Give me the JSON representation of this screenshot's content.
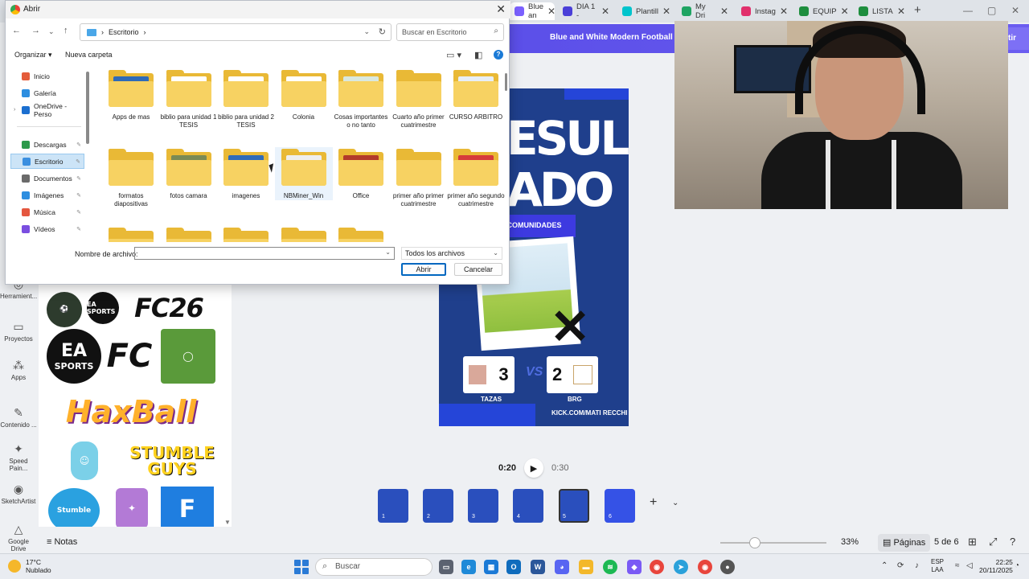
{
  "browser": {
    "tabs": [
      {
        "label": "Blue an",
        "color": "#7b61ff",
        "active": true
      },
      {
        "label": "DIA 1 -",
        "color": "#4a3fd8"
      },
      {
        "label": "Plantill",
        "color": "#00c4cc"
      },
      {
        "label": "My Dri",
        "color": "#1fa463"
      },
      {
        "label": "Instag",
        "color": "#e1306c"
      },
      {
        "label": "EQUIP",
        "color": "#1e8e3e"
      },
      {
        "label": "LISTA",
        "color": "#1e8e3e"
      }
    ],
    "new_tab": "+",
    "close_glyph": "✕"
  },
  "canva": {
    "doc_title": "Blue and White Modern Football M",
    "share_label": "tir",
    "rail": [
      {
        "label": "Herramient...",
        "icon": "◎"
      },
      {
        "label": "Proyectos",
        "icon": "▭"
      },
      {
        "label": "Apps",
        "icon": "⁂"
      },
      {
        "label": "Contenido ...",
        "icon": "✎"
      },
      {
        "label": "Speed Pain...",
        "icon": "✦"
      },
      {
        "label": "SketchArtist",
        "icon": "◉"
      },
      {
        "label": "Google Drive",
        "icon": "△"
      }
    ],
    "stickers": {
      "fc26": "FC26",
      "ea_sports": "EA SPORTS",
      "ea_short": "EA",
      "fc": "FC",
      "haxball": "HaxBall",
      "stumble_guys": "STUMBLE GUYS",
      "stumble": "Stumble",
      "f": "F"
    },
    "design": {
      "big_word_1": "ESUL",
      "big_word_2": "ADO",
      "banner": "ERCOMUNIDADES",
      "score_left": "3",
      "score_right": "2",
      "vs": "VS",
      "team_left": "TAZAS",
      "team_right": "BRG",
      "url": "KICK.COM/MATI RECCHI"
    },
    "player": {
      "current": "0:20",
      "total": "0:30"
    },
    "pages": [
      "1",
      "2",
      "3",
      "4",
      "5",
      "6"
    ],
    "current_page": 5,
    "bottom": {
      "notes": "Notas",
      "zoom": "33%",
      "pages_btn": "Páginas",
      "page_count": "5 de 6"
    }
  },
  "dialog": {
    "title": "Abrir",
    "address": "Escritorio",
    "search_placeholder": "Buscar en Escritorio",
    "organize": "Organizar ▾",
    "new_folder": "Nueva carpeta",
    "nav_items": [
      {
        "label": "Inicio",
        "color": "#e45c3a",
        "pinned": false
      },
      {
        "label": "Galería",
        "color": "#2d8ee0",
        "pinned": false
      },
      {
        "label": "OneDrive - Perso",
        "color": "#1b6fd0",
        "pinned": false
      },
      {
        "label": "Descargas",
        "color": "#2c9a4b",
        "pinned": true
      },
      {
        "label": "Escritorio",
        "color": "#3a8fe0",
        "pinned": true
      },
      {
        "label": "Documentos",
        "color": "#6a6a6a",
        "pinned": true
      },
      {
        "label": "Imágenes",
        "color": "#2d8ee0",
        "pinned": true
      },
      {
        "label": "Música",
        "color": "#e4573f",
        "pinned": true
      },
      {
        "label": "Vídeos",
        "color": "#7a4ee0",
        "pinned": true
      }
    ],
    "folders": [
      {
        "name": "Apps de mas",
        "paper": "#2f6bb8"
      },
      {
        "name": "biblio para unidad 1 TESIS",
        "paper": "#fff"
      },
      {
        "name": "biblio para unidad 2 TESIS",
        "paper": "#fff"
      },
      {
        "name": "Colonia",
        "paper": "#fff"
      },
      {
        "name": "Cosas importantes o no tanto",
        "paper": "#d9e8df"
      },
      {
        "name": "Cuarto año primer cuatrimestre",
        "paper": ""
      },
      {
        "name": "CURSO ARBITRO",
        "paper": "#e7eef6"
      },
      {
        "name": "formatos diapositivas",
        "paper": ""
      },
      {
        "name": "fotos camara",
        "paper": "#7a8a55"
      },
      {
        "name": "imagenes",
        "paper": "#2f6bb8"
      },
      {
        "name": "NBMiner_Win",
        "paper": "#eee"
      },
      {
        "name": "Office",
        "paper": "#b23a2a"
      },
      {
        "name": "primer año primer cuatrimestre",
        "paper": ""
      },
      {
        "name": "primer año segundo cuatrimestre",
        "paper": "#d63b3b"
      }
    ],
    "filename_label": "Nombre de archivo:",
    "filename_value": "",
    "filetype": "Todos los archivos",
    "open": "Abrir",
    "cancel": "Cancelar"
  },
  "taskbar": {
    "weather_temp": "17°C",
    "weather_desc": "Nublado",
    "search": "Buscar",
    "lang_1": "ESP",
    "lang_2": "LAA",
    "time": "22:25",
    "date": "20/11/2025"
  }
}
